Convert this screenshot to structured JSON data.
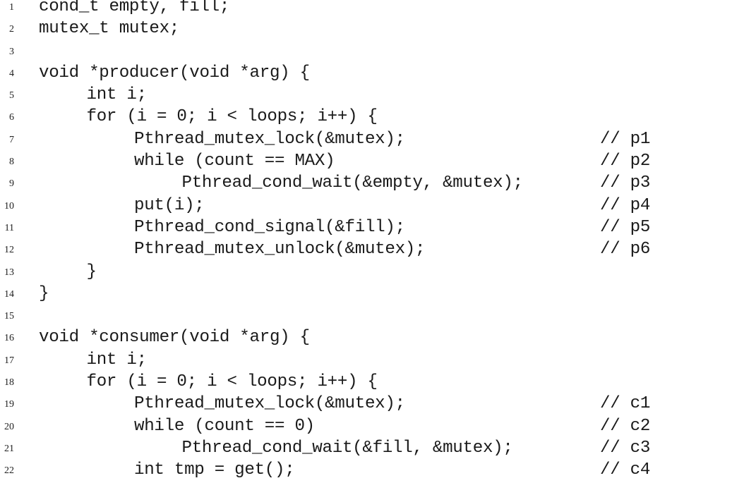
{
  "listing": {
    "lines": [
      {
        "num": "1",
        "indent": 0,
        "code": "cond_t empty, fill;",
        "comment": ""
      },
      {
        "num": "2",
        "indent": 0,
        "code": "mutex_t mutex;",
        "comment": ""
      },
      {
        "num": "3",
        "indent": 0,
        "code": "",
        "comment": ""
      },
      {
        "num": "4",
        "indent": 0,
        "code": "void *producer(void *arg) {",
        "comment": ""
      },
      {
        "num": "5",
        "indent": 1,
        "code": "int i;",
        "comment": ""
      },
      {
        "num": "6",
        "indent": 1,
        "code": "for (i = 0; i < loops; i++) {",
        "comment": ""
      },
      {
        "num": "7",
        "indent": 2,
        "code": "Pthread_mutex_lock(&mutex);",
        "comment": "// p1"
      },
      {
        "num": "8",
        "indent": 2,
        "code": "while (count == MAX)",
        "comment": "// p2"
      },
      {
        "num": "9",
        "indent": 3,
        "code": "Pthread_cond_wait(&empty, &mutex);",
        "comment": "// p3"
      },
      {
        "num": "10",
        "indent": 2,
        "code": "put(i);",
        "comment": "// p4"
      },
      {
        "num": "11",
        "indent": 2,
        "code": "Pthread_cond_signal(&fill);",
        "comment": "// p5"
      },
      {
        "num": "12",
        "indent": 2,
        "code": "Pthread_mutex_unlock(&mutex);",
        "comment": "// p6"
      },
      {
        "num": "13",
        "indent": 1,
        "code": "}",
        "comment": ""
      },
      {
        "num": "14",
        "indent": 0,
        "code": "}",
        "comment": ""
      },
      {
        "num": "15",
        "indent": 0,
        "code": "",
        "comment": ""
      },
      {
        "num": "16",
        "indent": 0,
        "code": "void *consumer(void *arg) {",
        "comment": ""
      },
      {
        "num": "17",
        "indent": 1,
        "code": "int i;",
        "comment": ""
      },
      {
        "num": "18",
        "indent": 1,
        "code": "for (i = 0; i < loops; i++) {",
        "comment": ""
      },
      {
        "num": "19",
        "indent": 2,
        "code": "Pthread_mutex_lock(&mutex);",
        "comment": "// c1"
      },
      {
        "num": "20",
        "indent": 2,
        "code": "while (count == 0)",
        "comment": "// c2"
      },
      {
        "num": "21",
        "indent": 3,
        "code": "Pthread_cond_wait(&fill, &mutex);",
        "comment": "// c3"
      },
      {
        "num": "22",
        "indent": 2,
        "code": "int tmp = get();",
        "comment": "// c4"
      }
    ]
  }
}
